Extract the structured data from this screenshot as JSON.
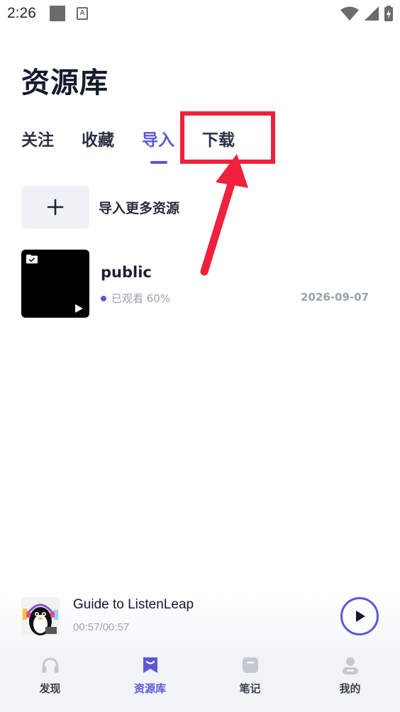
{
  "status_bar": {
    "time": "2:26",
    "notification_icon": "text-a-icon"
  },
  "page": {
    "title": "资源库"
  },
  "tabs": [
    {
      "label": "关注",
      "active": false
    },
    {
      "label": "收藏",
      "active": false
    },
    {
      "label": "导入",
      "active": true
    },
    {
      "label": "下载",
      "active": false
    }
  ],
  "import": {
    "label": "导入更多资源",
    "icon": "plus-icon"
  },
  "resources": [
    {
      "title": "public",
      "status": "已观看 60%",
      "progress_percent": 60,
      "date": "2026-09-07"
    }
  ],
  "player": {
    "title": "Guide to ListenLeap",
    "time": "00:57/00:57"
  },
  "nav": [
    {
      "label": "发现",
      "icon": "headphones-icon",
      "active": false
    },
    {
      "label": "资源库",
      "icon": "bookmark-icon",
      "active": true
    },
    {
      "label": "笔记",
      "icon": "note-icon",
      "active": false
    },
    {
      "label": "我的",
      "icon": "user-icon",
      "active": false
    }
  ],
  "colors": {
    "accent": "#5a58d6",
    "highlight": "#f0213c",
    "text": "#1c2233",
    "muted": "#9aa1ad"
  }
}
